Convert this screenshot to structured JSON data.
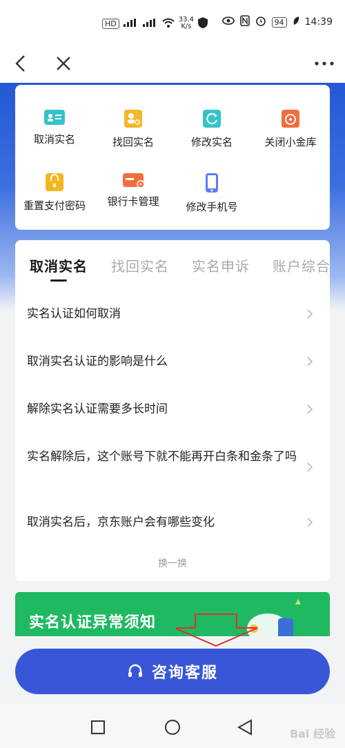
{
  "status": {
    "speed_value": "33.4",
    "speed_unit": "K/s",
    "battery": "94",
    "time": "14:39",
    "hd": "HD",
    "net": "4G"
  },
  "services": [
    {
      "label": "取消实名",
      "icon": "id-card-icon",
      "color": "#34c3c9"
    },
    {
      "label": "找回实名",
      "icon": "user-search-icon",
      "color": "#f4b62a"
    },
    {
      "label": "修改实名",
      "icon": "edit-id-icon",
      "color": "#34c3c9"
    },
    {
      "label": "关闭小金库",
      "icon": "vault-icon",
      "color": "#f36c3c"
    },
    {
      "label": "重置支付密码",
      "icon": "lock-icon",
      "color": "#f6b61e"
    },
    {
      "label": "银行卡管理",
      "icon": "bank-card-icon",
      "color": "#f36c3c"
    },
    {
      "label": "修改手机号",
      "icon": "phone-icon",
      "color": "#5b7cf0"
    }
  ],
  "tabs": [
    "取消实名",
    "找回实名",
    "实名申诉",
    "账户综合"
  ],
  "faqs": [
    "实名认证如何取消",
    "取消实名认证的影响是什么",
    "解除实名认证需要多长时间",
    "实名解除后，这个账号下就不能再开白条和金条了吗",
    "取消实名后，京东账户会有哪些变化"
  ],
  "refresh_label": "换一换",
  "banner_title": "实名认证异常须知",
  "consult_label": "咨询客服",
  "watermark": "Bai 经验"
}
